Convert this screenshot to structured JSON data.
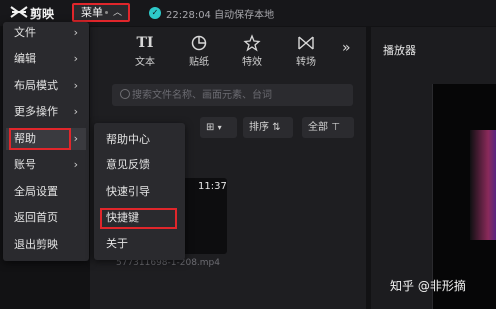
{
  "title_bar": {
    "app_name": "剪映",
    "menu_label": "菜单",
    "save_status": "22:28:04 自动保存本地"
  },
  "toolbar": {
    "items": [
      {
        "icon": "text-icon",
        "label": "文本"
      },
      {
        "icon": "sticker-icon",
        "label": "贴纸"
      },
      {
        "icon": "effects-icon",
        "label": "特效"
      },
      {
        "icon": "transition-icon",
        "label": "转场"
      }
    ],
    "more": "»"
  },
  "media": {
    "search_placeholder": "搜索文件名称、画面元素、台词",
    "sort_label": "排序",
    "filter_label": "全部",
    "thumb_duration": "11:37",
    "thumb_filename": "577311698-1-208.mp4"
  },
  "player": {
    "title": "播放器"
  },
  "main_menu": {
    "items": [
      {
        "label": "文件",
        "has_submenu": true
      },
      {
        "label": "编辑",
        "has_submenu": true
      },
      {
        "label": "布局模式",
        "has_submenu": true
      },
      {
        "label": "更多操作",
        "has_submenu": true
      },
      {
        "label": "帮助",
        "has_submenu": true
      },
      {
        "label": "账号",
        "has_submenu": true
      },
      {
        "label": "全局设置",
        "has_submenu": false
      },
      {
        "label": "返回首页",
        "has_submenu": false
      },
      {
        "label": "退出剪映",
        "has_submenu": false
      }
    ]
  },
  "help_submenu": {
    "items": [
      {
        "label": "帮助中心"
      },
      {
        "label": "意见反馈"
      },
      {
        "label": "快速引导"
      },
      {
        "label": "快捷键"
      },
      {
        "label": "关于"
      }
    ]
  },
  "watermark": "知乎 @非形摘",
  "colors": {
    "highlight_box": "#e0262b",
    "status_check": "#2ec9c9",
    "menu_bg": "#2a2a2e"
  }
}
